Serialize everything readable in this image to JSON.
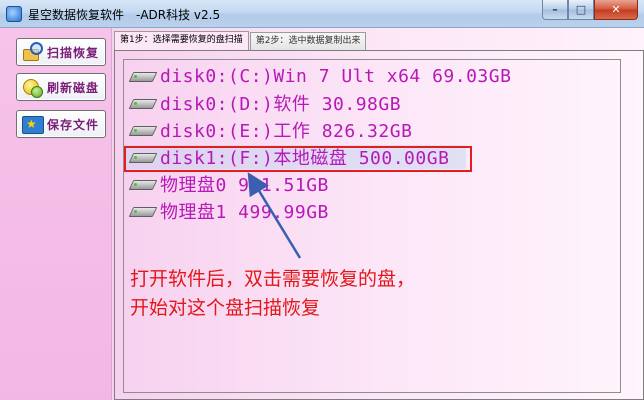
{
  "window": {
    "title": "星空数据恢复软件　-ADR科技 v2.5",
    "min_label": "–",
    "max_label": "□",
    "close_label": "✕"
  },
  "sidebar": {
    "items": [
      {
        "label": "扫描恢复",
        "icon": "scan-icon"
      },
      {
        "label": "刷新磁盘",
        "icon": "refresh-icon"
      },
      {
        "label": "保存文件",
        "icon": "save-icon"
      }
    ]
  },
  "tabs": [
    {
      "label": "第1步：选择需要恢复的盘扫描",
      "active": true
    },
    {
      "label": "第2步：选中数据复制出来",
      "active": false
    }
  ],
  "disks": [
    {
      "label": "disk0:(C:)Win 7 Ult x64 69.03GB"
    },
    {
      "label": "disk0:(D:)软件 30.98GB"
    },
    {
      "label": "disk0:(E:)工作 826.32GB"
    },
    {
      "label": "disk1:(F:)本地磁盘 500.00GB",
      "selected": true
    },
    {
      "label": "物理盘0 931.51GB"
    },
    {
      "label": "物理盘1 499.99GB"
    }
  ],
  "annotation": {
    "line1": "打开软件后，双击需要恢复的盘，",
    "line2": "开始对这个盘扫描恢复"
  },
  "colors": {
    "disk_text": "#b818b8",
    "annotation": "#e01818",
    "selection_box": "#e02020",
    "sidebar_label": "#7a1f78"
  }
}
